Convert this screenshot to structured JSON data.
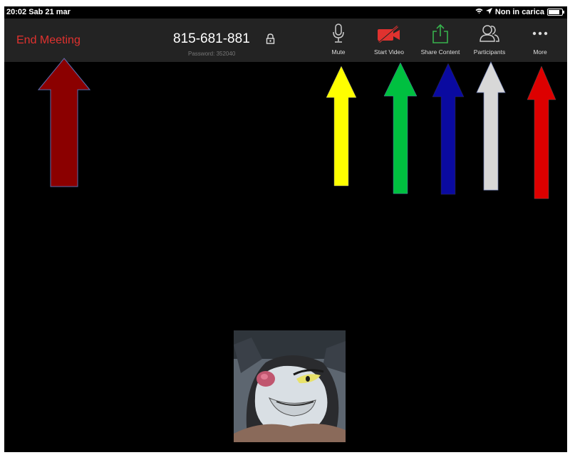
{
  "status_bar": {
    "time_date": "20:02  Sab 21 mar",
    "charging": "Non in carica",
    "battery_level": 0.85
  },
  "toolbar": {
    "end_meeting": "End Meeting",
    "meeting_id": "815-681-881",
    "password": "Password: 352040",
    "buttons": [
      {
        "label": "Mute",
        "icon": "microphone-icon"
      },
      {
        "label": "Start Video",
        "icon": "video-off-icon",
        "color": "#e0322f"
      },
      {
        "label": "Share Content",
        "icon": "share-icon",
        "color": "#37b24d"
      },
      {
        "label": "Participants",
        "icon": "participants-icon"
      },
      {
        "label": "More",
        "icon": "more-icon"
      }
    ]
  },
  "annotations": {
    "arrow_colors": [
      "#8b0000",
      "#ffff00",
      "#00c040",
      "#0a0aa0",
      "#d8d8d8",
      "#dd0000"
    ]
  },
  "video": {
    "thumbnail": "cartoon-cat-avatar"
  }
}
